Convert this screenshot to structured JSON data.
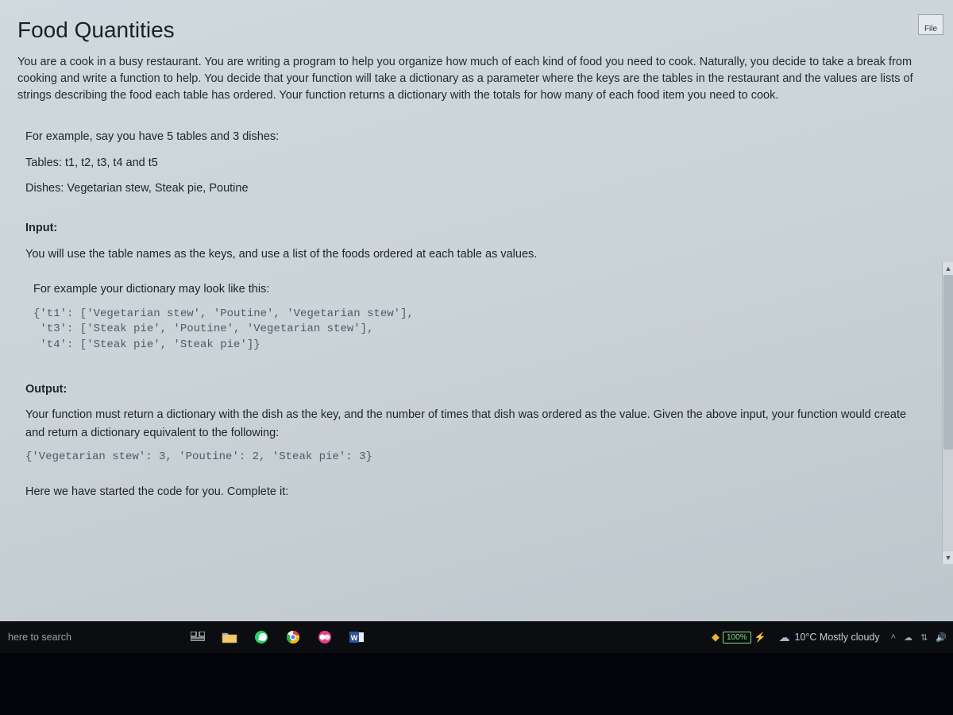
{
  "title": "Food Quantities",
  "file_button": "File",
  "intro": "You are a cook in a busy restaurant. You are writing a program to help you organize how much of each kind of food you need to cook. Naturally, you decide to take a break from cooking and write a function to help. You decide that your function will take a dictionary as a parameter where the keys are the tables in the restaurant and the values are lists of strings describing the food each table has ordered. Your function returns a dictionary with the totals for how many of each food item you need to cook.",
  "example": {
    "lead": "For example, say you have 5 tables and 3 dishes:",
    "tables": "Tables: t1, t2, t3, t4 and t5",
    "dishes": "Dishes: Vegetarian stew, Steak pie, Poutine"
  },
  "input": {
    "label": "Input:",
    "desc": "You will use the table names as the keys, and use a list of the foods ordered at each table as values.",
    "sub_lead": "For example your dictionary may look like this:",
    "code": "{'t1': ['Vegetarian stew', 'Poutine', 'Vegetarian stew'],\n 't3': ['Steak pie', 'Poutine', 'Vegetarian stew'],\n 't4': ['Steak pie', 'Steak pie']}"
  },
  "output": {
    "label": "Output:",
    "desc": "Your function must return a dictionary with the dish as the key, and the number of times that dish was ordered as the value. Given the above input, your function would create and return a dictionary equivalent to the following:",
    "code": "{'Vegetarian stew': 3, 'Poutine': 2, 'Steak pie': 3}",
    "footer": "Here we have started the code for you. Complete it:"
  },
  "taskbar": {
    "search_placeholder": "here to search",
    "battery": "100%",
    "weather": "10°C Mostly cloudy"
  }
}
